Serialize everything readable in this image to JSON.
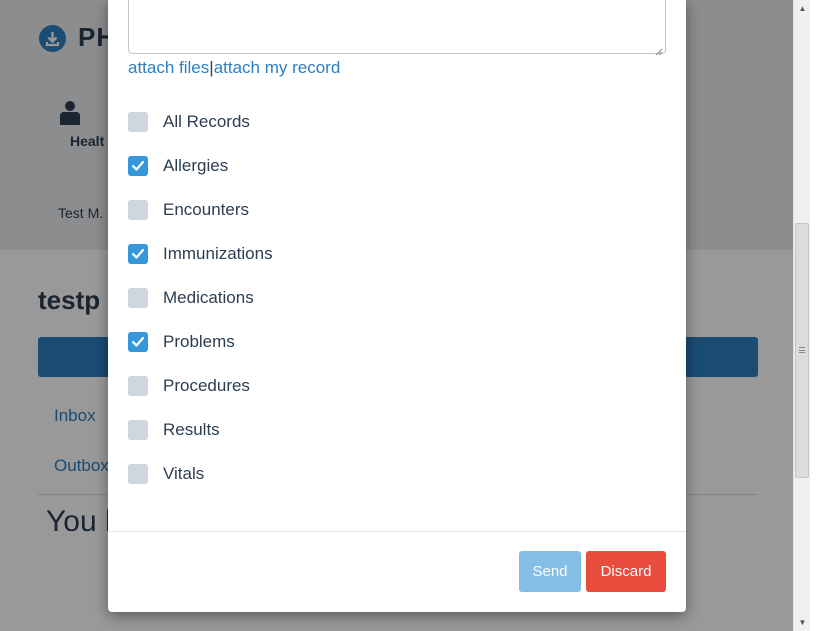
{
  "background": {
    "app_title": "PH",
    "health_label": "Healt",
    "user_name": "Test M.",
    "heading": "testp",
    "nav": {
      "inbox": "Inbox",
      "outbox": "Outbox"
    },
    "empty_message": "You h"
  },
  "modal": {
    "attach_files": "attach files",
    "separator": "|",
    "attach_record": "attach my record",
    "records": [
      {
        "label": "All Records",
        "checked": false
      },
      {
        "label": "Allergies",
        "checked": true
      },
      {
        "label": "Encounters",
        "checked": false
      },
      {
        "label": "Immunizations",
        "checked": true
      },
      {
        "label": "Medications",
        "checked": false
      },
      {
        "label": "Problems",
        "checked": true
      },
      {
        "label": "Procedures",
        "checked": false
      },
      {
        "label": "Results",
        "checked": false
      },
      {
        "label": "Vitals",
        "checked": false
      }
    ],
    "send_label": "Send",
    "discard_label": "Discard"
  },
  "colors": {
    "accent": "#2d7fc1",
    "checked": "#3498db",
    "discard": "#e74c3c",
    "send_disabled": "#84bde6"
  }
}
